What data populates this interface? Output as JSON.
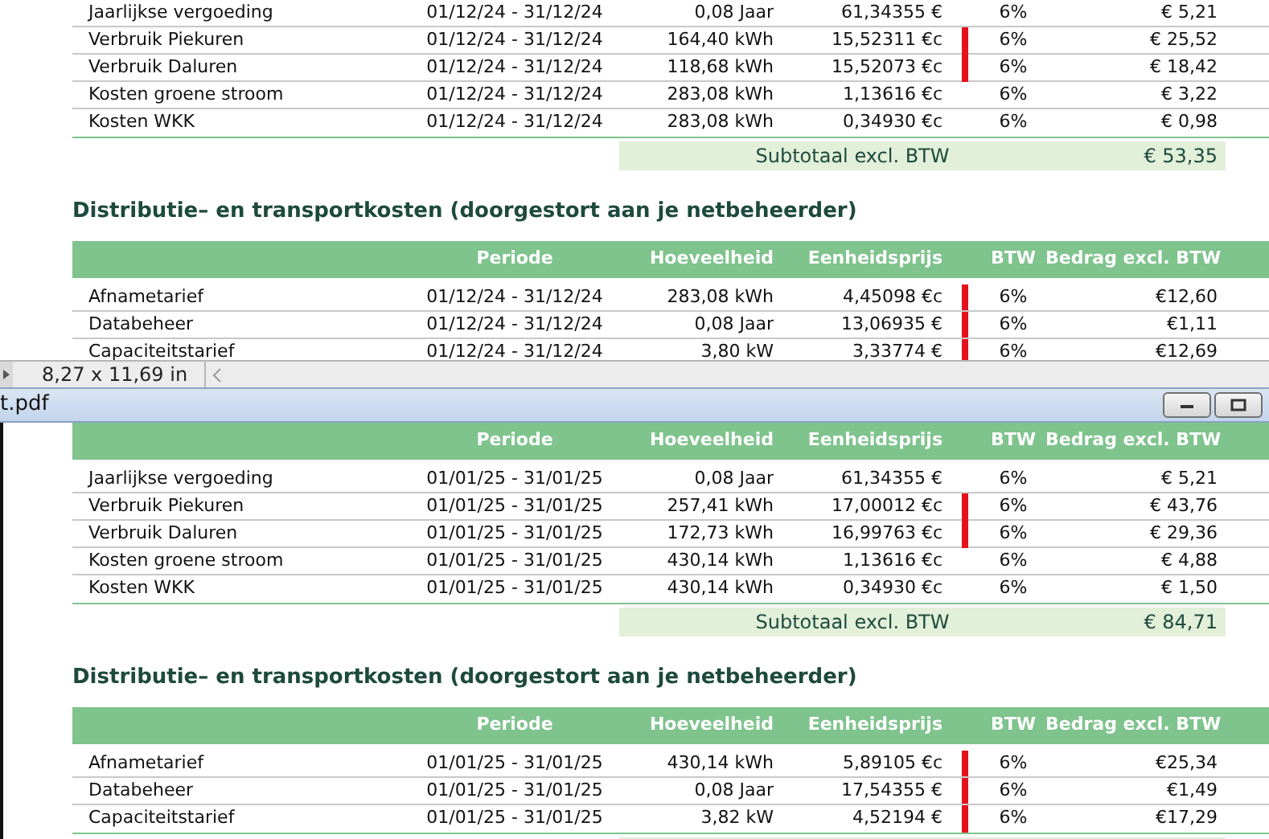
{
  "top_page": {
    "tables": [
      {
        "rows": [
          {
            "cells": [
              "Jaarlijkse vergoeding",
              "01/12/24 - 31/12/24",
              "0,08 Jaar",
              "61,34355 €",
              "6%",
              "€ 5,21"
            ],
            "marked": false
          },
          {
            "cells": [
              "Verbruik Piekuren",
              "01/12/24 - 31/12/24",
              "164,40 kWh",
              "15,52311 €c",
              "6%",
              "€ 25,52"
            ],
            "marked": true
          },
          {
            "cells": [
              "Verbruik Daluren",
              "01/12/24 - 31/12/24",
              "118,68 kWh",
              "15,52073 €c",
              "6%",
              "€ 18,42"
            ],
            "marked": true
          },
          {
            "cells": [
              "Kosten groene stroom",
              "01/12/24 - 31/12/24",
              "283,08 kWh",
              "1,13616 €c",
              "6%",
              "€ 3,22"
            ],
            "marked": false
          },
          {
            "cells": [
              "Kosten WKK",
              "01/12/24 - 31/12/24",
              "283,08 kWh",
              "0,34930 €c",
              "6%",
              "€ 0,98"
            ],
            "marked": false
          }
        ],
        "subtotal": {
          "label": "Subtotaal excl. BTW",
          "amount": "€ 53,35"
        }
      },
      {
        "heading": "Distributie– en transportkosten (doorgestort aan je netbeheerder)",
        "columns": [
          "",
          "Periode",
          "Hoeveelheid",
          "Eenheidsprijs",
          "BTW",
          "Bedrag excl. BTW"
        ],
        "rows": [
          {
            "cells": [
              "Afnametarief",
              "01/12/24 - 31/12/24",
              "283,08 kWh",
              "4,45098 €c",
              "6%",
              "€12,60"
            ],
            "marked": true
          },
          {
            "cells": [
              "Databeheer",
              "01/12/24 - 31/12/24",
              "0,08 Jaar",
              "13,06935 €",
              "6%",
              "€1,11"
            ],
            "marked": true
          },
          {
            "cells": [
              "Capaciteitstarief",
              "01/12/24 - 31/12/24",
              "3,80 kW",
              "3,33774 €",
              "6%",
              "€12,69"
            ],
            "marked": true
          }
        ]
      }
    ]
  },
  "status_bar": {
    "page_size": "8,27 x 11,69 in"
  },
  "window": {
    "title": "t.pdf"
  },
  "bottom_page": {
    "tables": [
      {
        "columns": [
          "",
          "Periode",
          "Hoeveelheid",
          "Eenheidsprijs",
          "BTW",
          "Bedrag excl. BTW"
        ],
        "rows": [
          {
            "cells": [
              "Jaarlijkse vergoeding",
              "01/01/25 - 31/01/25",
              "0,08 Jaar",
              "61,34355 €",
              "6%",
              "€ 5,21"
            ],
            "marked": false
          },
          {
            "cells": [
              "Verbruik Piekuren",
              "01/01/25 - 31/01/25",
              "257,41 kWh",
              "17,00012 €c",
              "6%",
              "€ 43,76"
            ],
            "marked": true
          },
          {
            "cells": [
              "Verbruik Daluren",
              "01/01/25 - 31/01/25",
              "172,73 kWh",
              "16,99763 €c",
              "6%",
              "€ 29,36"
            ],
            "marked": true
          },
          {
            "cells": [
              "Kosten groene stroom",
              "01/01/25 - 31/01/25",
              "430,14 kWh",
              "1,13616 €c",
              "6%",
              "€ 4,88"
            ],
            "marked": false
          },
          {
            "cells": [
              "Kosten WKK",
              "01/01/25 - 31/01/25",
              "430,14 kWh",
              "0,34930 €c",
              "6%",
              "€ 1,50"
            ],
            "marked": false
          }
        ],
        "subtotal": {
          "label": "Subtotaal excl. BTW",
          "amount": "€ 84,71"
        }
      },
      {
        "heading": "Distributie– en transportkosten (doorgestort aan je netbeheerder)",
        "columns": [
          "",
          "Periode",
          "Hoeveelheid",
          "Eenheidsprijs",
          "BTW",
          "Bedrag excl. BTW"
        ],
        "rows": [
          {
            "cells": [
              "Afnametarief",
              "01/01/25 - 31/01/25",
              "430,14 kWh",
              "5,89105 €c",
              "6%",
              "€25,34"
            ],
            "marked": true
          },
          {
            "cells": [
              "Databeheer",
              "01/01/25 - 31/01/25",
              "0,08 Jaar",
              "17,54355 €",
              "6%",
              "€1,49"
            ],
            "marked": true
          },
          {
            "cells": [
              "Capaciteitstarief",
              "01/01/25 - 31/01/25",
              "3,82 kW",
              "4,52194 €",
              "6%",
              "€17,29"
            ],
            "marked": true
          }
        ],
        "subtotal_cut": true
      }
    ]
  }
}
